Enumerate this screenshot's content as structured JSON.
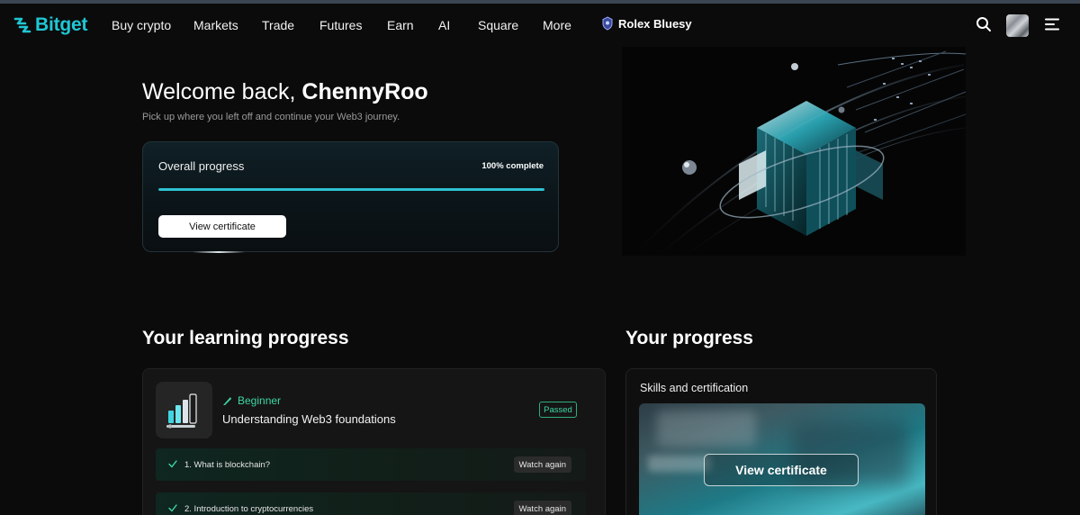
{
  "nav": {
    "brand": "Bitget",
    "items": [
      {
        "label": "Buy crypto"
      },
      {
        "label": "Markets"
      },
      {
        "label": "Trade"
      },
      {
        "label": "Futures"
      },
      {
        "label": "Earn"
      },
      {
        "label": "AI"
      },
      {
        "label": "Square"
      },
      {
        "label": "More"
      }
    ],
    "user_chip": "Rolex Bluesy",
    "icons": [
      "search-icon",
      "avatar",
      "menu-icon"
    ]
  },
  "hero": {
    "welcome_prefix": "Welcome back,",
    "username": "ChennyRoo",
    "subtitle": "Pick up where you left off and continue your Web3 journey.",
    "overall_label": "Overall progress",
    "percent_text": "100% complete",
    "progress": 1.0,
    "certificate_button": "View certificate"
  },
  "learning": {
    "title": "Your learning progress",
    "course": {
      "level": "Beginner",
      "title": "Understanding Web3 foundations",
      "status": "Passed",
      "lessons": [
        {
          "name": "1. What is blockchain?",
          "action": "Watch again"
        },
        {
          "name": "2. Introduction to cryptocurrencies",
          "action": "Watch again"
        }
      ]
    }
  },
  "your_progress": {
    "title": "Your progress",
    "card_label": "Skills and certification",
    "button": "View certificate"
  },
  "colors": {
    "brand": "#1fc7d4",
    "accent_green": "#3ed7a0",
    "progress_fill": "#2fc2d3",
    "background": "#0b0b0b"
  }
}
